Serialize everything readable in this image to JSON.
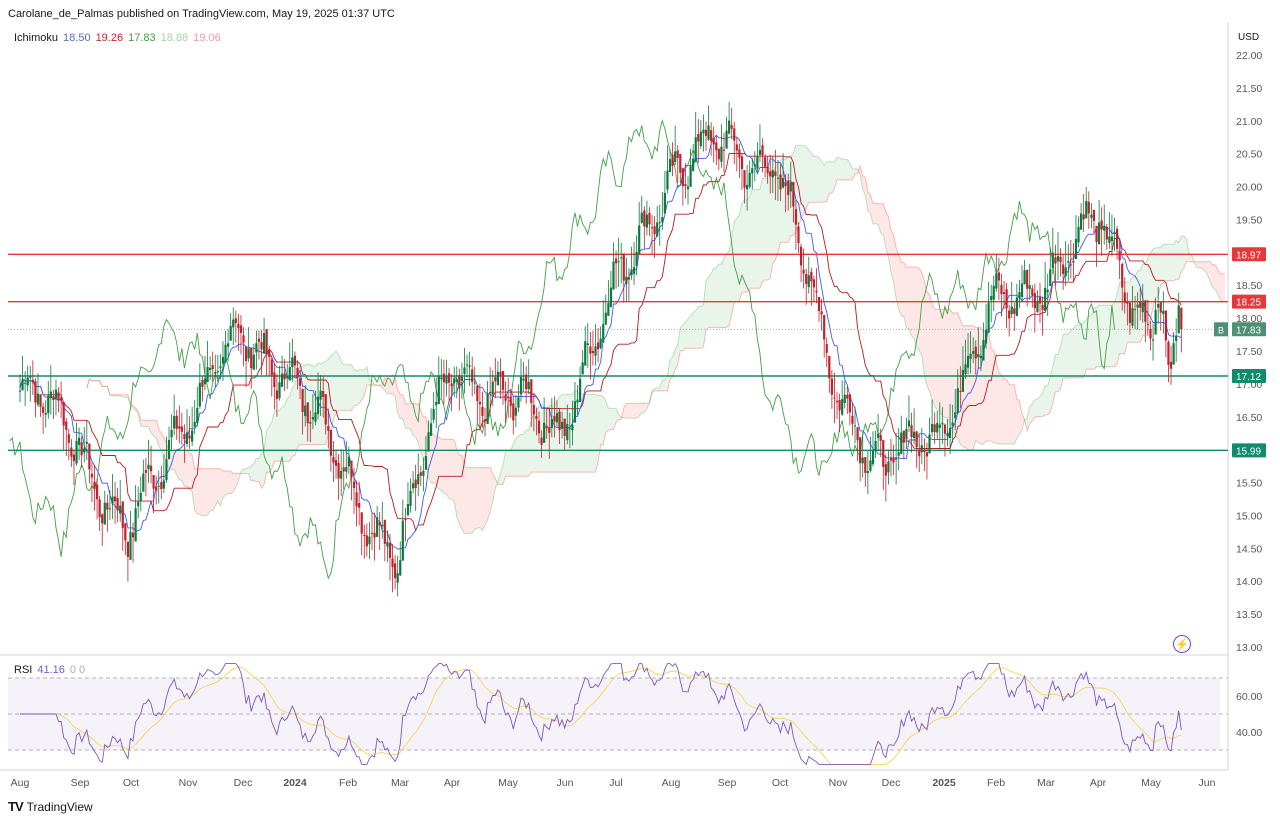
{
  "header": {
    "published": "Carolane_de_Palmas published on TradingView.com, May 19, 2025 01:37 UTC"
  },
  "ichimoku_legend": {
    "label": "Ichimoku",
    "values": [
      {
        "text": "18.50",
        "color": "#2962ff"
      },
      {
        "text": "19.26",
        "color": "#b71c1c"
      },
      {
        "text": "17.83",
        "color": "#43a047"
      },
      {
        "text": "18.88",
        "color": "#a5d6a7"
      },
      {
        "text": "19.06",
        "color": "#ef9a9a"
      }
    ]
  },
  "rsi_legend": {
    "label": "RSI",
    "value": "41.16",
    "extra": "0 0"
  },
  "axis": {
    "currency": "USD",
    "price_ticks": [
      "22.00",
      "21.50",
      "21.00",
      "20.50",
      "20.00",
      "19.50",
      "19.00",
      "18.50",
      "18.00",
      "17.50",
      "17.00",
      "16.50",
      "16.00",
      "15.50",
      "15.00",
      "14.50",
      "14.00",
      "13.50",
      "13.00"
    ],
    "rsi_ticks": [
      "60.00",
      "40.00"
    ],
    "time_ticks": [
      "Aug",
      "Sep",
      "Oct",
      "Nov",
      "Dec",
      "2024",
      "Feb",
      "Mar",
      "Apr",
      "May",
      "Jun",
      "Jul",
      "Aug",
      "Sep",
      "Oct",
      "Nov",
      "Dec",
      "2025",
      "Feb",
      "Mar",
      "Apr",
      "May",
      "Jun"
    ]
  },
  "levels": [
    {
      "price": 18.97,
      "label": "18.97",
      "color": "#e5383b"
    },
    {
      "price": 18.25,
      "label": "18.25",
      "color": "#e5383b"
    },
    {
      "price": 17.12,
      "label": "17.12",
      "color": "#138a6b"
    },
    {
      "price": 15.99,
      "label": "15.99",
      "color": "#138a6b"
    }
  ],
  "last_price": {
    "label": "17.83",
    "marker": "B",
    "color": "#4e8f76"
  },
  "logo": {
    "text": "TradingView"
  },
  "chart_data": {
    "type": "candlestick",
    "x_range": [
      "2023-08",
      "2025-06"
    ],
    "ylim": [
      13.0,
      22.0
    ],
    "y_unit": "USD",
    "close_path_by_month": [
      {
        "month": "2023-08",
        "close": 16.9
      },
      {
        "month": "2023-09",
        "close": 16.3
      },
      {
        "month": "2023-10",
        "close": 14.6
      },
      {
        "month": "2023-11",
        "close": 16.5
      },
      {
        "month": "2023-12",
        "close": 17.6
      },
      {
        "month": "2024-01",
        "close": 17.3
      },
      {
        "month": "2024-02",
        "close": 15.6
      },
      {
        "month": "2024-03",
        "close": 14.4
      },
      {
        "month": "2024-04",
        "close": 17.3
      },
      {
        "month": "2024-05",
        "close": 16.7
      },
      {
        "month": "2024-06",
        "close": 16.4
      },
      {
        "month": "2024-07",
        "close": 18.3
      },
      {
        "month": "2024-08",
        "close": 20.2
      },
      {
        "month": "2024-09",
        "close": 20.6
      },
      {
        "month": "2024-10",
        "close": 20.4
      },
      {
        "month": "2024-11",
        "close": 17.3
      },
      {
        "month": "2024-12",
        "close": 15.6
      },
      {
        "month": "2025-01",
        "close": 16.4
      },
      {
        "month": "2025-02",
        "close": 18.0
      },
      {
        "month": "2025-03",
        "close": 18.7
      },
      {
        "month": "2025-04",
        "close": 19.4
      },
      {
        "month": "2025-05",
        "close": 17.8
      }
    ],
    "rsi": {
      "ylim": [
        20,
        80
      ],
      "bands": [
        30,
        50,
        70
      ],
      "last": 41.16
    }
  }
}
